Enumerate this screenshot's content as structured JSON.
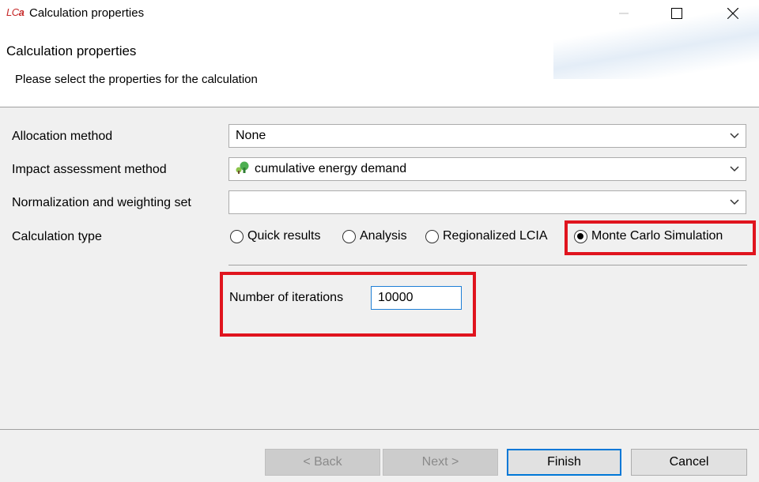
{
  "window": {
    "app_icon_text_main": "LC",
    "app_icon_text_a": "a",
    "title": "Calculation properties"
  },
  "header": {
    "title": "Calculation properties",
    "description": "Please select the properties for the calculation"
  },
  "form": {
    "allocation": {
      "label": "Allocation method",
      "value": "None"
    },
    "impact": {
      "label": "Impact assessment method",
      "value": "cumulative energy demand",
      "icon": "impact-method-icon"
    },
    "normalization": {
      "label": "Normalization and weighting set",
      "value": ""
    },
    "calc_type": {
      "label": "Calculation type",
      "options": [
        "Quick results",
        "Analysis",
        "Regionalized LCIA",
        "Monte Carlo Simulation"
      ],
      "selected": "Monte Carlo Simulation"
    },
    "iterations": {
      "label": "Number of iterations",
      "value": "10000"
    }
  },
  "buttons": {
    "back": "< Back",
    "next": "Next >",
    "finish": "Finish",
    "cancel": "Cancel"
  },
  "colors": {
    "highlight": "#e0141e",
    "focus": "#0078d7",
    "accent_green": "#4caf50"
  }
}
